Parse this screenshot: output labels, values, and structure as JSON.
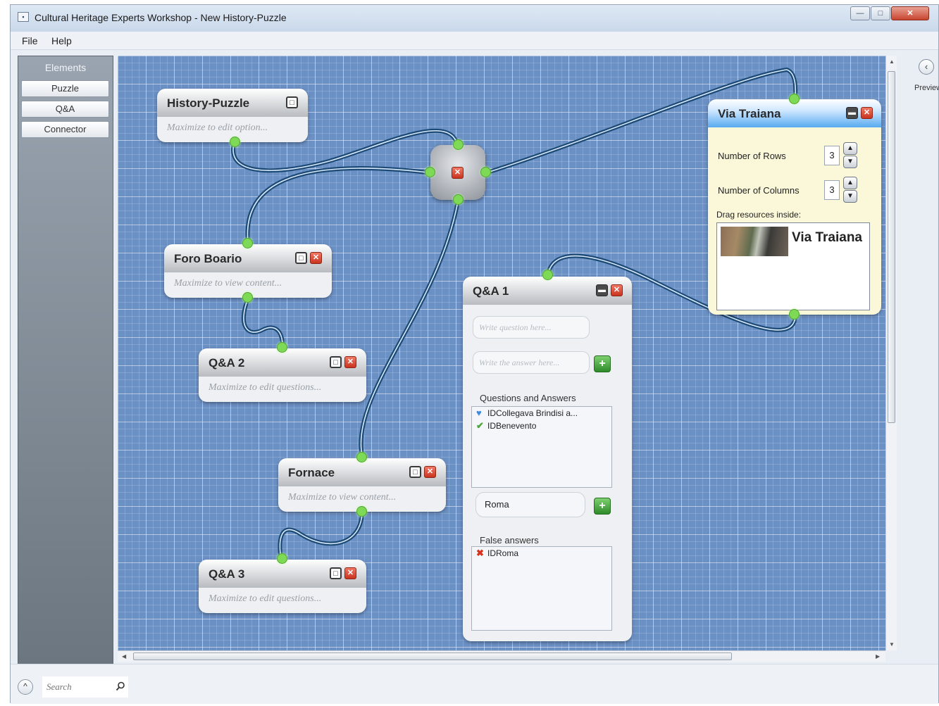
{
  "window": {
    "title": "Cultural Heritage Experts Workshop - New History-Puzzle",
    "icon": "app-window-icon",
    "min": "—",
    "max": "□",
    "close": "✕"
  },
  "menu": {
    "file": "File",
    "help": "Help"
  },
  "palette": {
    "title": "Elements",
    "items": [
      "Puzzle",
      "Q&A",
      "Connector"
    ]
  },
  "preview": {
    "label": "Preview",
    "button_icon": "chevron-left-icon",
    "glyph": "‹"
  },
  "search": {
    "placeholder": "Search",
    "icon": "search-icon"
  },
  "bottom": {
    "collapse_glyph": "^"
  },
  "nodes": {
    "history_puzzle": {
      "title": "History-Puzzle",
      "hint": "Maximize to edit option..."
    },
    "foro_boario": {
      "title": "Foro Boario",
      "hint": "Maximize to view content..."
    },
    "qa2": {
      "title": "Q&A 2",
      "hint": "Maximize to edit questions..."
    },
    "fornace": {
      "title": "Fornace",
      "hint": "Maximize to view content..."
    },
    "qa3": {
      "title": "Q&A 3",
      "hint": "Maximize to edit questions..."
    },
    "qa1": {
      "title": "Q&A 1",
      "question_placeholder": "Write question here...",
      "answer_placeholder": "Write the answer here...",
      "qa_label": "Questions and Answers",
      "qa_items": [
        {
          "mark": "heart-check-icon",
          "text": "IDCollegava Brindisi a..."
        },
        {
          "mark": "check-icon",
          "text": "IDBenevento"
        }
      ],
      "false_input": "Roma",
      "false_label": "False answers",
      "false_items": [
        {
          "mark": "cross-icon",
          "text": "IDRoma"
        }
      ]
    },
    "via_traiana": {
      "title": "Via Traiana",
      "rows_label": "Number of Rows",
      "rows_value": "3",
      "cols_label": "Number of Columns",
      "cols_value": "3",
      "drag_label": "Drag resources inside:",
      "resource_name": "Via Traiana"
    }
  },
  "colors": {
    "canvas": "#6b90c4",
    "port": "#7ed957",
    "wire": "#2e5e8a",
    "close": "#c9341f",
    "accent": "#58aaf0"
  }
}
